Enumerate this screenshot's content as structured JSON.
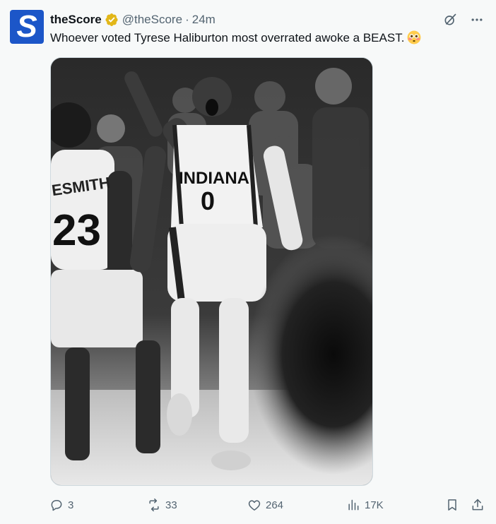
{
  "account": {
    "display_name": "theScore",
    "handle": "@theScore",
    "separator": "·",
    "timestamp": "24m",
    "avatar_letter": "S"
  },
  "tweet": {
    "text": "Whoever voted Tyrese Haliburton most overrated awoke a BEAST.",
    "emoji": "flushed-face"
  },
  "media": {
    "jersey_text_main": "INDIANA",
    "jersey_number_main": "0",
    "jersey_text_left": "ESMITH",
    "jersey_number_left": "23"
  },
  "actions": {
    "replies": "3",
    "reposts": "33",
    "likes": "264",
    "views": "17K"
  },
  "colors": {
    "brand_blue": "#1c56c8",
    "verified_gold": "#e2b719",
    "muted_text": "#536471",
    "background": "#f7f9f9"
  },
  "icons": [
    "verified-badge-icon",
    "grok-icon",
    "more-icon",
    "reply-icon",
    "repost-icon",
    "like-icon",
    "views-icon",
    "bookmark-icon",
    "share-icon"
  ]
}
